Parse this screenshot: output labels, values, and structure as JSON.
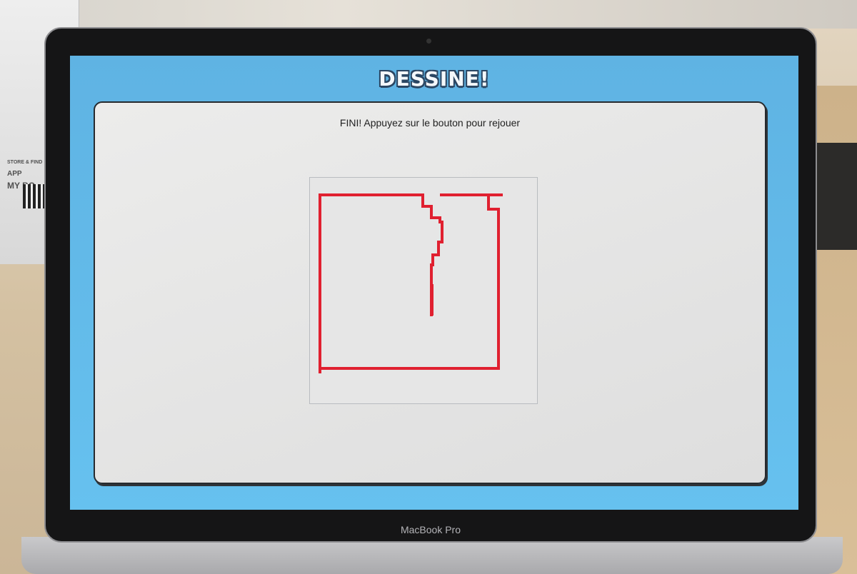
{
  "scene": {
    "laptop_label": "MacBook Pro",
    "background_box_text": [
      "STORE & FIND",
      "APP",
      "MY BO"
    ]
  },
  "app": {
    "title": "DESSINE!",
    "status_message": "FINI! Appuyez sur le bouton pour rejouer",
    "drawing": {
      "stroke_color": "#e02030",
      "canvas_background": "#e6e6e6"
    }
  },
  "colors": {
    "screen_background": "#66c1ef",
    "panel_background": "#e4e4e4",
    "title_outline": "#2b4662",
    "cursor": "#1faa3a"
  }
}
